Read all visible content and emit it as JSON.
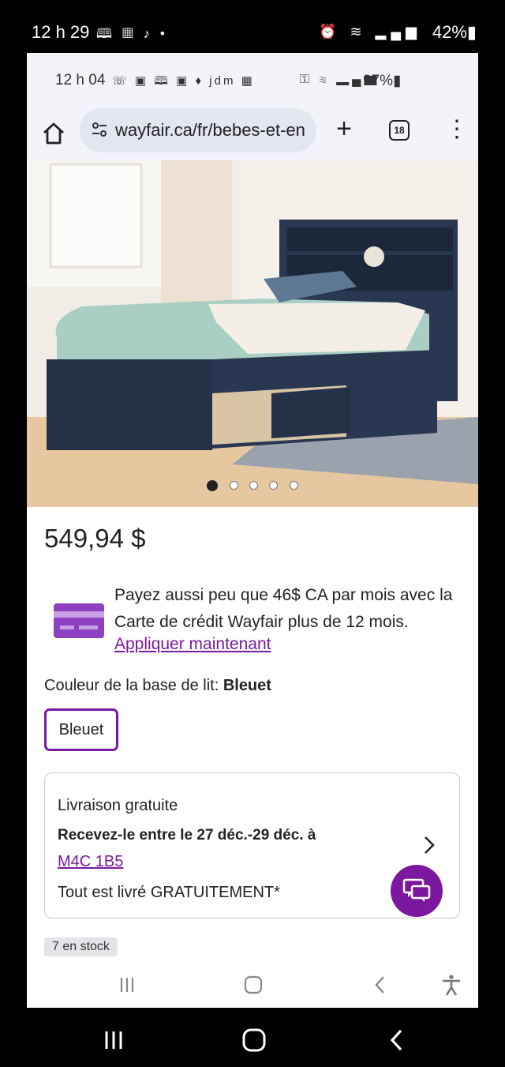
{
  "outer_status": {
    "time": "12 h 29",
    "left_icons": "🕮 ▦ ♪ •",
    "right_icons": "⏰ ≋ ▂▄▆",
    "battery": "42%▮"
  },
  "inner_status": {
    "time": "12 h 04",
    "left_icons": "☏ ▣ 🕮 ▣ ♦ jdm ▦",
    "right_icons": "⚿ ≋ ▂▄▆",
    "battery": "97%▮"
  },
  "browser": {
    "url": "wayfair.ca/fr/bebes-et-en",
    "tab_count": "18",
    "plus_label": "+",
    "menu_label": "⋮"
  },
  "carousel": {
    "image_count": 5,
    "active_index": 0
  },
  "product": {
    "price": "549,94 $",
    "promo_text": "Payez aussi peu que 46$ CA par mois avec la Carte de crédit Wayfair plus de 12 mois.",
    "promo_link": "Appliquer maintenant",
    "color_label": "Couleur de la base de lit: ",
    "color_value": "Bleuet",
    "swatch_label": "Bleuet"
  },
  "delivery": {
    "title": "Livraison gratuite",
    "eta": "Recevez-le entre le 27 déc.-29 déc. à",
    "postal_code": "M4C 1B5",
    "note": "Tout est livré GRATUITEMENT*"
  },
  "stock": "7 en stock",
  "colors": {
    "accent": "#7b189f",
    "bed_navy": "#243149",
    "mattress": "#a9cfc4"
  }
}
